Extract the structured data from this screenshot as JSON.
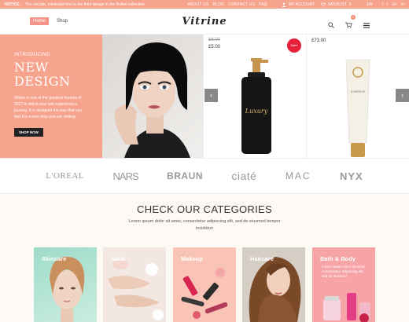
{
  "topbar": {
    "notice_label": "NOTICE :",
    "notice_text": "The circular, minimalist line is the third design in the Bulbel collection.",
    "nav": [
      "ABOUT US",
      "BLOG",
      "CONTACT US",
      "FAQ"
    ],
    "account": "MY ACCOUNT",
    "wishlist": "WISHLIST",
    "wishlist_count": "0",
    "language": "EN",
    "social": [
      "f",
      "t",
      "G+",
      "in"
    ]
  },
  "header": {
    "nav": [
      "Home",
      "Shop"
    ],
    "logo": "Vitrine",
    "cart_count": "0"
  },
  "hero": {
    "intro": "INTRODUCING",
    "title_line1": "NEW",
    "title_line2": "DESIGN",
    "description": "Vitrine is one of the greatest themes of 2017 in which ever will experience a journey. It is designed the way that you feel it is a real shop you are visiting.",
    "button": "SHOP NOW",
    "product1_old_price": "£6.00",
    "product1_price": "£5.00",
    "sale_badge": "Sale!",
    "bottle_label": "Luxury",
    "product2_price": "£73.00",
    "tube_label": "SYNERGIE"
  },
  "brands": [
    "L'OREAL",
    "NARS",
    "BRAUN",
    "ciaté",
    "MAC",
    "NYX"
  ],
  "categories": {
    "title": "CHECK OUR CATEGORIES",
    "description": "Lorem ipsum dolor sit amet, consectetur adipiscing elit, sed do eiusmod tempor incididun",
    "items": [
      {
        "label": "Skincare"
      },
      {
        "label": "Nails"
      },
      {
        "label": "Makeup"
      },
      {
        "label": "Haircare"
      },
      {
        "label": "Bath & Body",
        "description": "Lorem ipsum dolor sit amet, Consectetur adipiscing elit, sed do eiusmod"
      }
    ]
  },
  "colors": {
    "accent": "#f7a48e",
    "sale": "#e8213a",
    "dark": "#222222"
  }
}
